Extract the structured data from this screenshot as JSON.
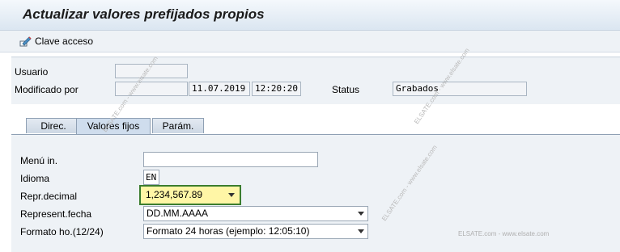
{
  "title": "Actualizar valores prefijados propios",
  "toolbar": {
    "clave_acceso": "Clave acceso",
    "icon": "pencil-key-icon"
  },
  "header": {
    "usuario_label": "Usuario",
    "usuario_value": "",
    "modificado_label": "Modificado por",
    "modificado_value": "",
    "date": "11.07.2019",
    "time": "12:20:20",
    "status_label": "Status",
    "status_value": "Grabados"
  },
  "tabs": [
    {
      "label": "Direc.",
      "active": false
    },
    {
      "label": "Valores fijos",
      "active": true
    },
    {
      "label": "Parám.",
      "active": false
    }
  ],
  "form": {
    "menu_label": "Menú in.",
    "menu_value": "",
    "idioma_label": "Idioma",
    "idioma_value": "EN",
    "decimal_label": "Repr.decimal",
    "decimal_value": "1,234,567.89",
    "fecha_label": "Represent.fecha",
    "fecha_value": "DD.MM.AAAA",
    "hora_label": "Formato ho.(12/24)",
    "hora_value": "Formato 24 horas (ejemplo: 12:05:10)"
  },
  "watermarks": {
    "w1": "ELSATE.com - www.elsate.com",
    "w2": "ELSATE.com - www.elsate.com",
    "w3": "ELSATE.com - www.elsate.com",
    "w4": "ELSATE.com - www.elsate.com"
  },
  "colors": {
    "focus_border": "#3b7d2f",
    "focus_fill": "#fff6a6",
    "active_tab": "#cfdded"
  }
}
